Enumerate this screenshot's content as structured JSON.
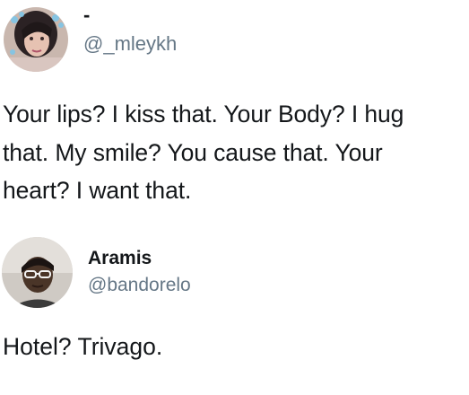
{
  "tweets": [
    {
      "display_name": "-",
      "handle": "@_mleykh",
      "text_lines": [
        "Your lips? I kiss that. Your Body? I hug",
        "that. My smile? You cause that. Your",
        "heart? I want that."
      ]
    },
    {
      "display_name": "Aramis",
      "handle": "@bandorelo",
      "text_lines": [
        "Hotel? Trivago."
      ]
    }
  ],
  "colors": {
    "text": "#14171a",
    "handle": "#657786",
    "background": "#ffffff"
  }
}
